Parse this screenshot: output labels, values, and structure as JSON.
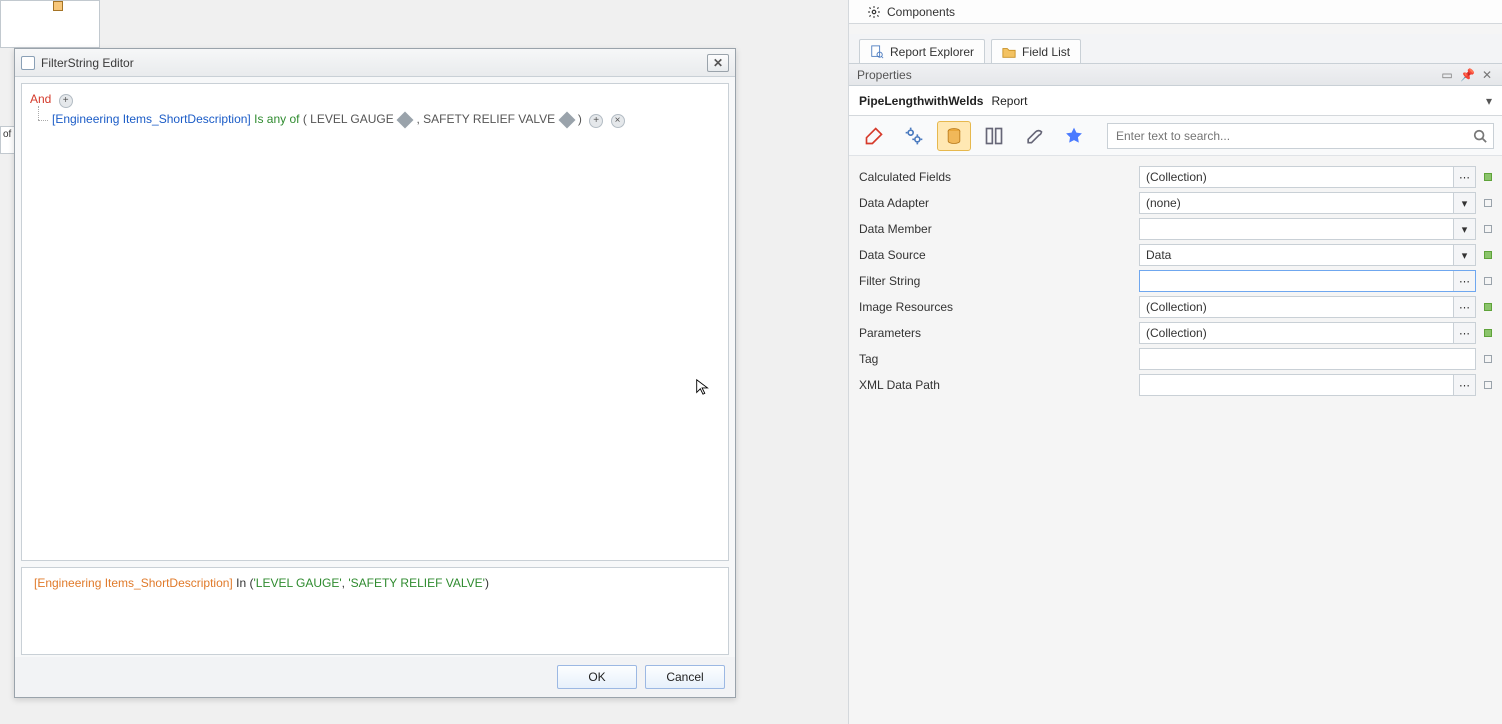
{
  "dialog": {
    "title": "FilterString Editor",
    "and_label": "And",
    "field_link": "[Engineering Items_ShortDescription]",
    "operator": "Is any of",
    "val1": "LEVEL GAUGE",
    "val2": "SAFETY RELIEF VALVE",
    "expr_prefix": "[Engineering Items_ShortDescription]",
    "expr_kw": "In",
    "expr_open": "(",
    "expr_s1": "'LEVEL GAUGE'",
    "expr_comma": ", ",
    "expr_s2": "'SAFETY RELIEF VALVE'",
    "expr_close": ")",
    "ok": "OK",
    "cancel": "Cancel"
  },
  "right": {
    "components_label": "Components",
    "tab_report_explorer": "Report Explorer",
    "tab_field_list": "Field List",
    "properties_label": "Properties",
    "obj_name": "PipeLengthwithWelds",
    "obj_type": "Report",
    "search_placeholder": "Enter text to search...",
    "rows": [
      {
        "label": "Calculated Fields",
        "value": "(Collection)",
        "btn": "⋯",
        "marker": "green"
      },
      {
        "label": "Data Adapter",
        "value": "(none)",
        "btn": "▾",
        "marker": "empty"
      },
      {
        "label": "Data Member",
        "value": "",
        "btn": "▾",
        "marker": "empty"
      },
      {
        "label": "Data Source",
        "value": "Data",
        "btn": "▾",
        "marker": "green"
      },
      {
        "label": "Filter String",
        "value": "",
        "btn": "⋯",
        "marker": "empty",
        "selected": true
      },
      {
        "label": "Image Resources",
        "value": "(Collection)",
        "btn": "⋯",
        "marker": "green"
      },
      {
        "label": "Parameters",
        "value": "(Collection)",
        "btn": "⋯",
        "marker": "green"
      },
      {
        "label": "Tag",
        "value": "",
        "btn": "",
        "marker": "empty"
      },
      {
        "label": "XML Data Path",
        "value": "",
        "btn": "⋯",
        "marker": "empty"
      }
    ]
  }
}
